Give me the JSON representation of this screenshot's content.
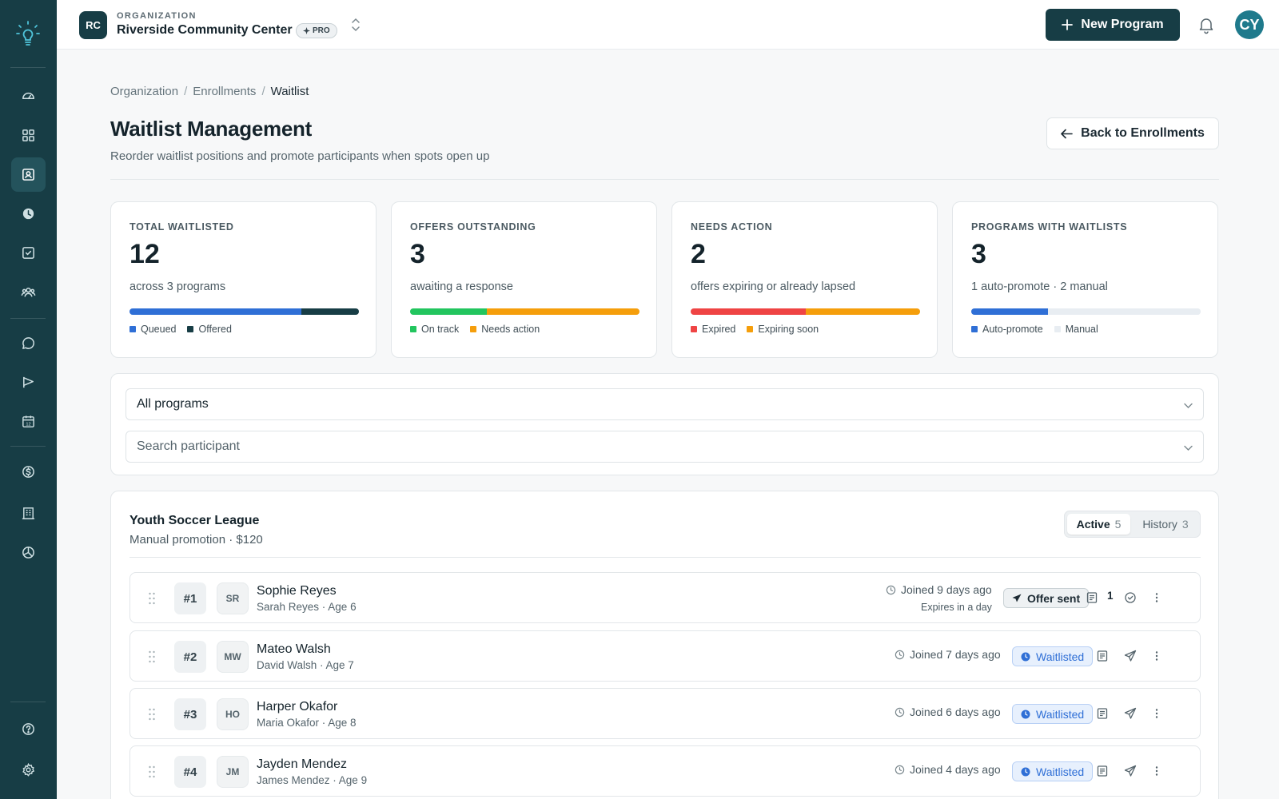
{
  "colors": {
    "sidebar": "#173d45",
    "accent": "#173d45",
    "blue": "#2f6fd6",
    "green": "#22c55e",
    "orange": "#f59e0b",
    "red": "#ef4444",
    "dark": "#173d45",
    "track": "#e8edf2"
  },
  "sidebar": {
    "items": [
      {
        "icon": "gauge-icon"
      },
      {
        "icon": "grid-icon"
      },
      {
        "icon": "contact-card-icon",
        "active": true
      },
      {
        "icon": "clock-icon"
      },
      {
        "icon": "checkbox-icon"
      },
      {
        "icon": "people-icon"
      },
      {
        "icon": "chat-icon"
      },
      {
        "icon": "megaphone-icon"
      },
      {
        "icon": "calendar-icon"
      },
      {
        "icon": "dollar-icon"
      },
      {
        "icon": "building-icon"
      },
      {
        "icon": "pie-chart-icon"
      },
      {
        "icon": "help-icon"
      },
      {
        "icon": "settings-icon"
      }
    ]
  },
  "topbar": {
    "org_initials": "RC",
    "org_kicker": "ORGANIZATION",
    "org_name": "Riverside Community Center",
    "plan_badge": "PRO",
    "new_program_label": "New Program",
    "user_initials": "CY"
  },
  "breadcrumb": [
    "Organization",
    "Enrollments",
    "Waitlist"
  ],
  "page": {
    "title": "Waitlist Management",
    "subtitle": "Reorder waitlist positions and promote participants when spots open up",
    "back_label": "Back to Enrollments"
  },
  "stats": [
    {
      "label": "TOTAL WAITLISTED",
      "value": "12",
      "desc": "across 3 programs",
      "segments": [
        {
          "name": "Queued",
          "fraction": 0.75,
          "color": "#2f6fd6"
        },
        {
          "name": "Offered",
          "fraction": 0.25,
          "color": "#173d45"
        }
      ]
    },
    {
      "label": "OFFERS OUTSTANDING",
      "value": "3",
      "desc": "awaiting a response",
      "segments": [
        {
          "name": "On track",
          "fraction": 0.333,
          "color": "#22c55e"
        },
        {
          "name": "Needs action",
          "fraction": 0.667,
          "color": "#f59e0b"
        }
      ]
    },
    {
      "label": "NEEDS ACTION",
      "value": "2",
      "desc": "offers expiring or already lapsed",
      "segments": [
        {
          "name": "Expired",
          "fraction": 0.5,
          "color": "#ef4444"
        },
        {
          "name": "Expiring soon",
          "fraction": 0.5,
          "color": "#f59e0b"
        }
      ]
    },
    {
      "label": "PROGRAMS WITH WAITLISTS",
      "value": "3",
      "desc": "1 auto-promote · 2 manual",
      "segments": [
        {
          "name": "Auto-promote",
          "fraction": 0.333,
          "color": "#2f6fd6"
        },
        {
          "name": "Manual",
          "fraction": 0.667,
          "color": "#e8edf2"
        }
      ]
    }
  ],
  "filters": {
    "program_select": "All programs",
    "participant_search": "Search participant"
  },
  "program": {
    "name": "Youth Soccer League",
    "meta": "Manual promotion · $120",
    "tabs": [
      {
        "label": "Active",
        "count": "5"
      },
      {
        "label": "History",
        "count": "3"
      }
    ]
  },
  "rows": [
    {
      "position": "#1",
      "initials": "SR",
      "name": "Sophie Reyes",
      "parent": "Sarah Reyes · Age 6",
      "joined": "Joined 9 days ago",
      "expires": "Expires in a day",
      "status": "Offer sent",
      "status_type": "offer",
      "note_count": "1"
    },
    {
      "position": "#2",
      "initials": "MW",
      "name": "Mateo Walsh",
      "parent": "David Walsh · Age 7",
      "joined": "Joined 7 days ago",
      "expires": "",
      "status": "Waitlisted",
      "status_type": "wait",
      "note_count": ""
    },
    {
      "position": "#3",
      "initials": "HO",
      "name": "Harper Okafor",
      "parent": "Maria Okafor · Age 8",
      "joined": "Joined 6 days ago",
      "expires": "",
      "status": "Waitlisted",
      "status_type": "wait",
      "note_count": ""
    },
    {
      "position": "#4",
      "initials": "JM",
      "name": "Jayden Mendez",
      "parent": "James Mendez · Age 9",
      "joined": "Joined 4 days ago",
      "expires": "",
      "status": "Waitlisted",
      "status_type": "wait",
      "note_count": ""
    }
  ]
}
